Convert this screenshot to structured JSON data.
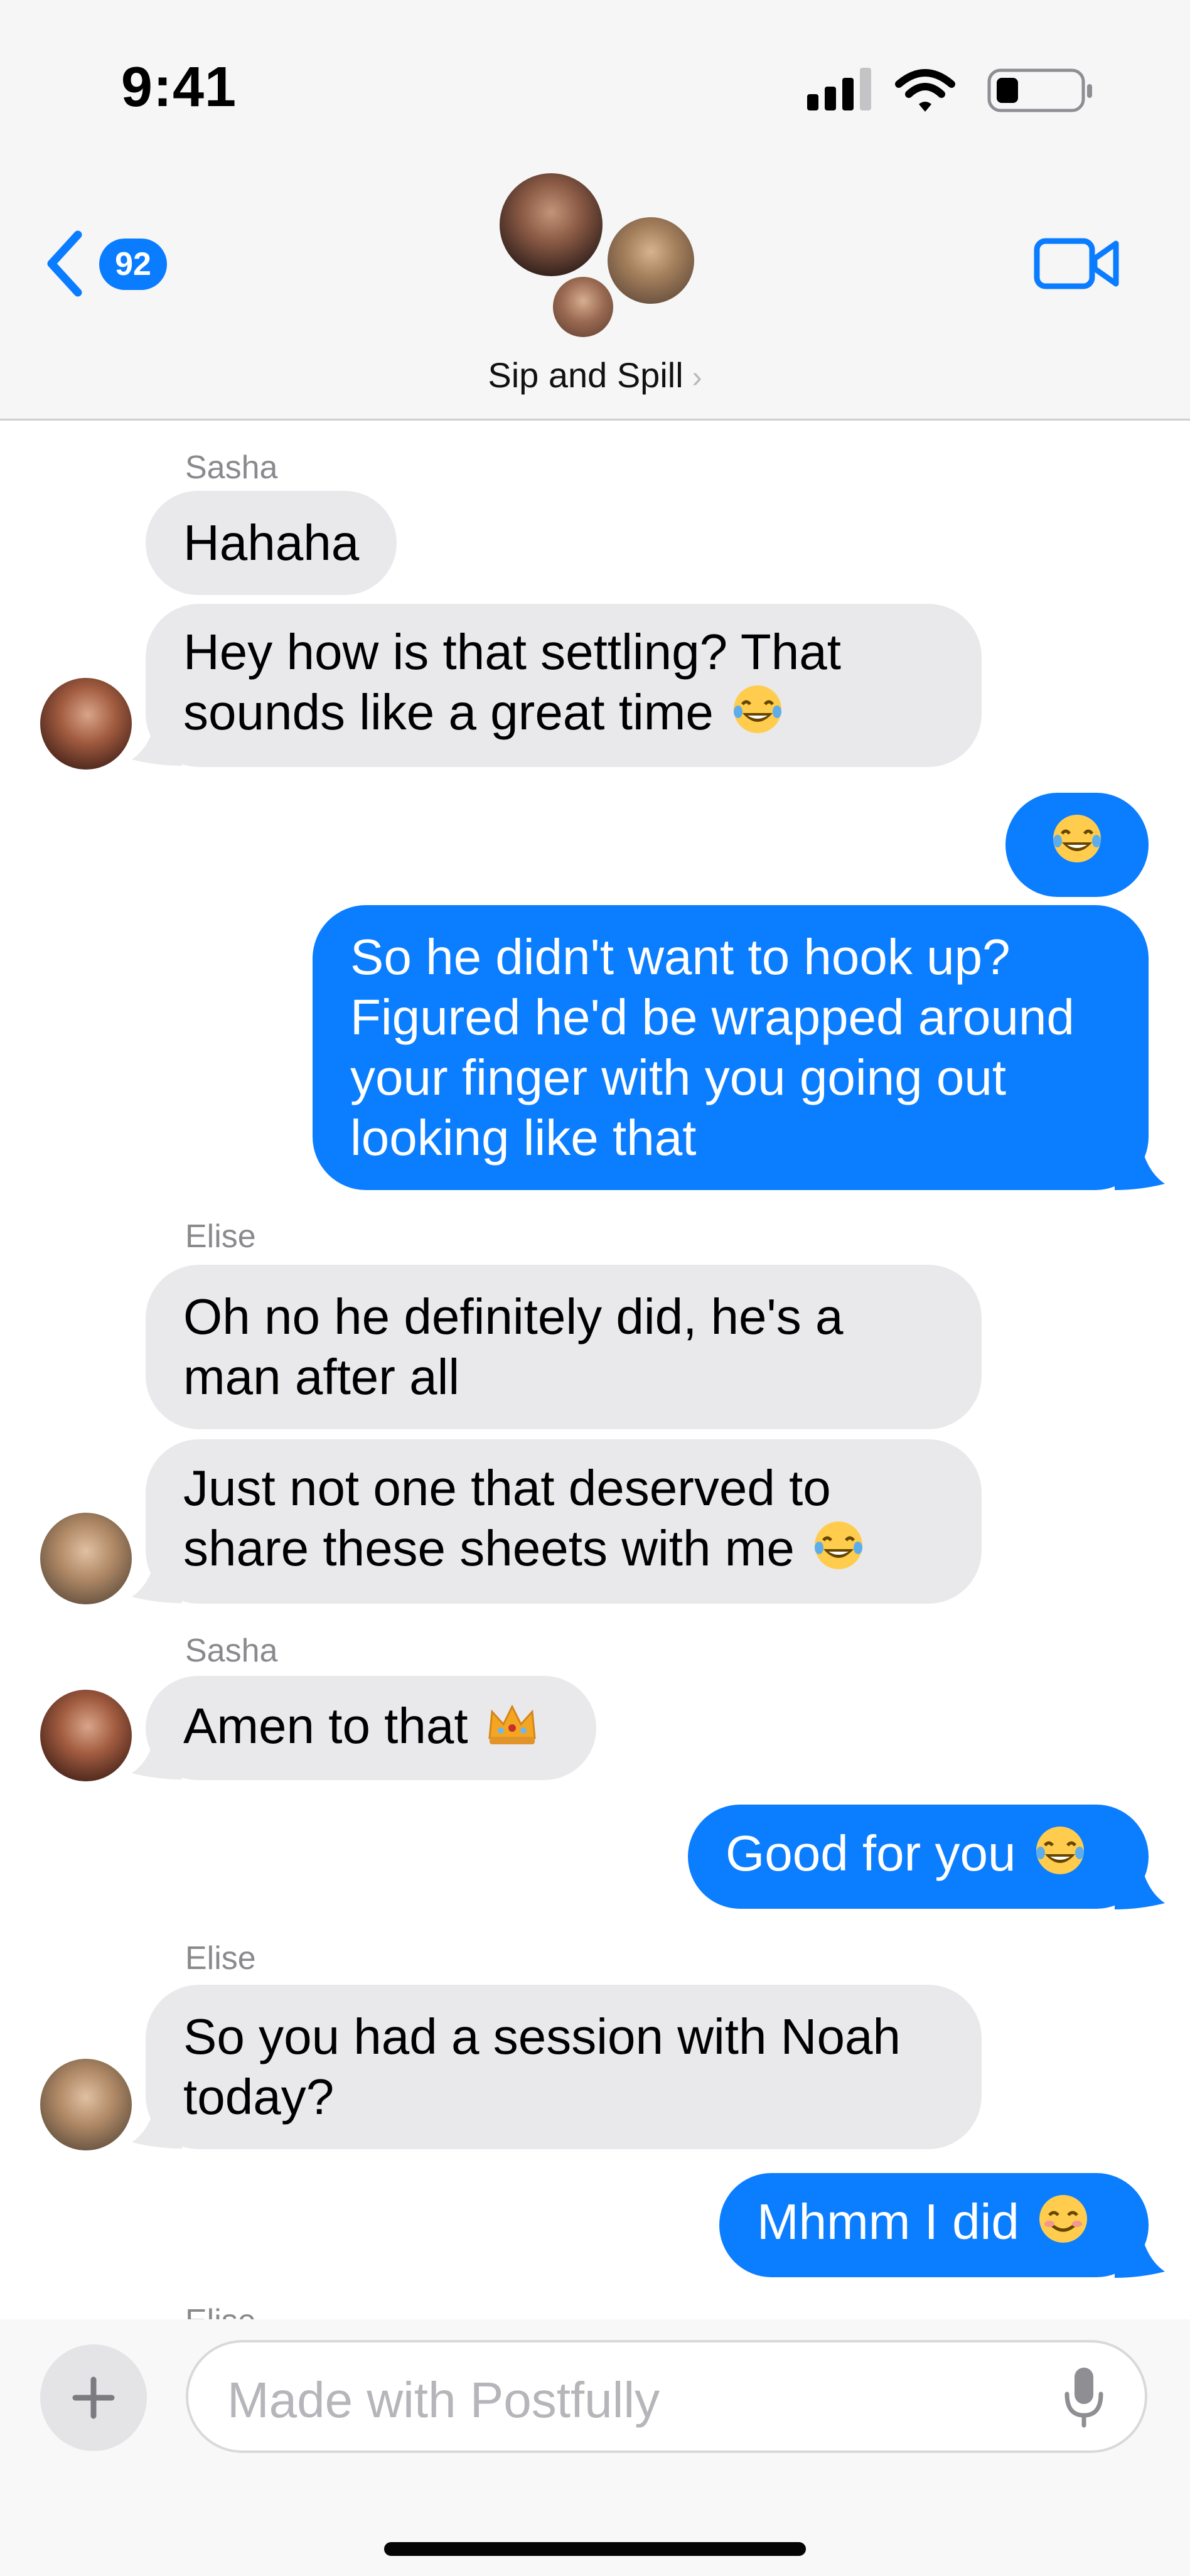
{
  "status_bar": {
    "time": "9:41"
  },
  "header": {
    "back_badge": "92",
    "group_name": "Sip and Spill",
    "chevron": "›"
  },
  "messages": [
    {
      "sender": "Sasha"
    },
    {
      "text": "Hahaha"
    },
    {
      "text": "Hey how is that settling? That\nsounds like a great time",
      "emoji": "laughing-tears"
    },
    {
      "emoji": "laughing-tears"
    },
    {
      "text": "So he didn't want to hook up?\nFigured he'd be wrapped around\nyour finger with you going out\nlooking like that"
    },
    {
      "sender": "Elise"
    },
    {
      "text": "Oh no he definitely did, he's a\nman after all"
    },
    {
      "text": "Just not one that deserved to\nshare these sheets with me",
      "emoji": "laughing-tears"
    },
    {
      "sender": "Sasha"
    },
    {
      "text": "Amen to that",
      "emoji": "crown"
    },
    {
      "text": "Good for you",
      "emoji": "laughing-tears"
    },
    {
      "sender": "Elise"
    },
    {
      "text": "So you had a session with Noah\ntoday?"
    },
    {
      "text": "Mhmm I did",
      "emoji": "smiling-face"
    },
    {
      "sender": "Elise"
    }
  ],
  "composer": {
    "placeholder": "Made with Postfully",
    "plus": "+"
  },
  "colors": {
    "outgoing": "#0b7dff",
    "incoming": "#e9e9eb",
    "accent": "#0a7cff"
  }
}
